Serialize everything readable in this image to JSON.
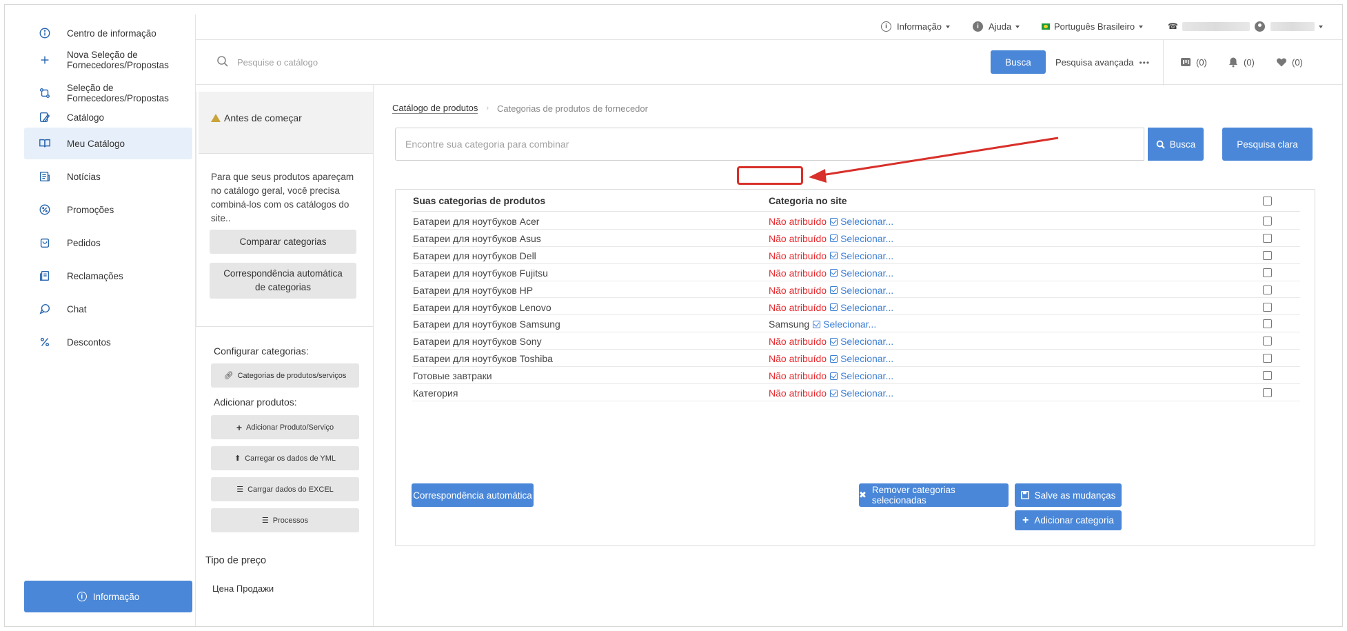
{
  "sidebar": {
    "items": [
      {
        "label": "Centro de informação",
        "icon": "info-circle-icon"
      },
      {
        "label": "Nova Seleção de\nFornecedores/Propostas",
        "icon": "plus-icon"
      },
      {
        "label": "Seleção de\nFornecedores/Propostas",
        "icon": "swap-icon"
      },
      {
        "label": "Catálogo",
        "icon": "catalog-icon"
      },
      {
        "label": "Meu Catálogo",
        "icon": "book-icon"
      },
      {
        "label": "Notícias",
        "icon": "news-icon"
      },
      {
        "label": "Promoções",
        "icon": "percent-badge-icon"
      },
      {
        "label": "Pedidos",
        "icon": "bag-icon"
      },
      {
        "label": "Reclamações",
        "icon": "complaint-icon"
      },
      {
        "label": "Chat",
        "icon": "chat-icon"
      },
      {
        "label": "Descontos",
        "icon": "percent-icon"
      }
    ],
    "info_button": "Informação"
  },
  "topbar": {
    "info": "Informação",
    "help": "Ajuda",
    "language": "Português Brasileiro"
  },
  "search": {
    "placeholder": "Pesquise o catálogo",
    "button": "Busca",
    "advanced": "Pesquisa avançada",
    "compare_count": "(0)",
    "notif_count": "(0)",
    "fav_count": "(0)"
  },
  "left_panel": {
    "warning_title": "Antes de começar",
    "description": "Para que seus produtos apareçam no catálogo geral, você precisa combiná-los com os catálogos do site..",
    "compare_button": "Comparar categorias",
    "auto_match_button": "Correspondência automática de categorias",
    "configure_label": "Configurar categorias:",
    "categories_button": "Categorias de produtos/serviços",
    "add_products_label": "Adicionar produtos:",
    "add_product_button": "Adicionar Produto/Serviço",
    "yml_button": "Carregar os dados de YML",
    "excel_button": "Carrgar dados do EXCEL",
    "processes_button": "Processos",
    "price_type_label": "Tipo de preço",
    "price_type_value": "Цена Продажи"
  },
  "main": {
    "breadcrumb_root": "Catálogo de produtos",
    "breadcrumb_current": "Categorias de produtos de fornecedor",
    "category_search_placeholder": "Encontre sua categoria para combinar",
    "search_button": "Busca",
    "clear_button": "Pesquisa clara",
    "col_your_categories": "Suas categorias de produtos",
    "col_site_category": "Categoria no site",
    "select_label": "Selecionar...",
    "rows": [
      {
        "name": "Батареи для ноутбуков Acer",
        "status": "Não atribuído",
        "assigned": false
      },
      {
        "name": "Батареи для ноутбуков Asus",
        "status": "Não atribuído",
        "assigned": false
      },
      {
        "name": "Батареи для ноутбуков Dell",
        "status": "Não atribuído",
        "assigned": false
      },
      {
        "name": "Батареи для ноутбуков Fujitsu",
        "status": "Não atribuído",
        "assigned": false
      },
      {
        "name": "Батареи для ноутбуков HP",
        "status": "Não atribuído",
        "assigned": false
      },
      {
        "name": "Батареи для ноутбуков Lenovo",
        "status": "Não atribuído",
        "assigned": false
      },
      {
        "name": "Батареи для ноутбуков Samsung",
        "status": "Samsung",
        "assigned": true
      },
      {
        "name": "Батареи для ноутбуков Sony",
        "status": "Não atribuído",
        "assigned": false
      },
      {
        "name": "Батареи для ноутбуков Toshiba",
        "status": "Não atribuído",
        "assigned": false
      },
      {
        "name": "Готовые завтраки",
        "status": "Não atribuído",
        "assigned": false
      },
      {
        "name": "Категория",
        "status": "Não atribuído",
        "assigned": false
      }
    ],
    "auto_match_button": "Correspondência automática",
    "remove_button": "Remover categorias selecionadas",
    "save_button": "Salve as mudanças",
    "add_category_button": "Adicionar categoria"
  },
  "colors": {
    "accent": "#4a87d8",
    "unassigned": "#e8292d",
    "link": "#3b7ed4",
    "annotation": "#d8302a"
  }
}
